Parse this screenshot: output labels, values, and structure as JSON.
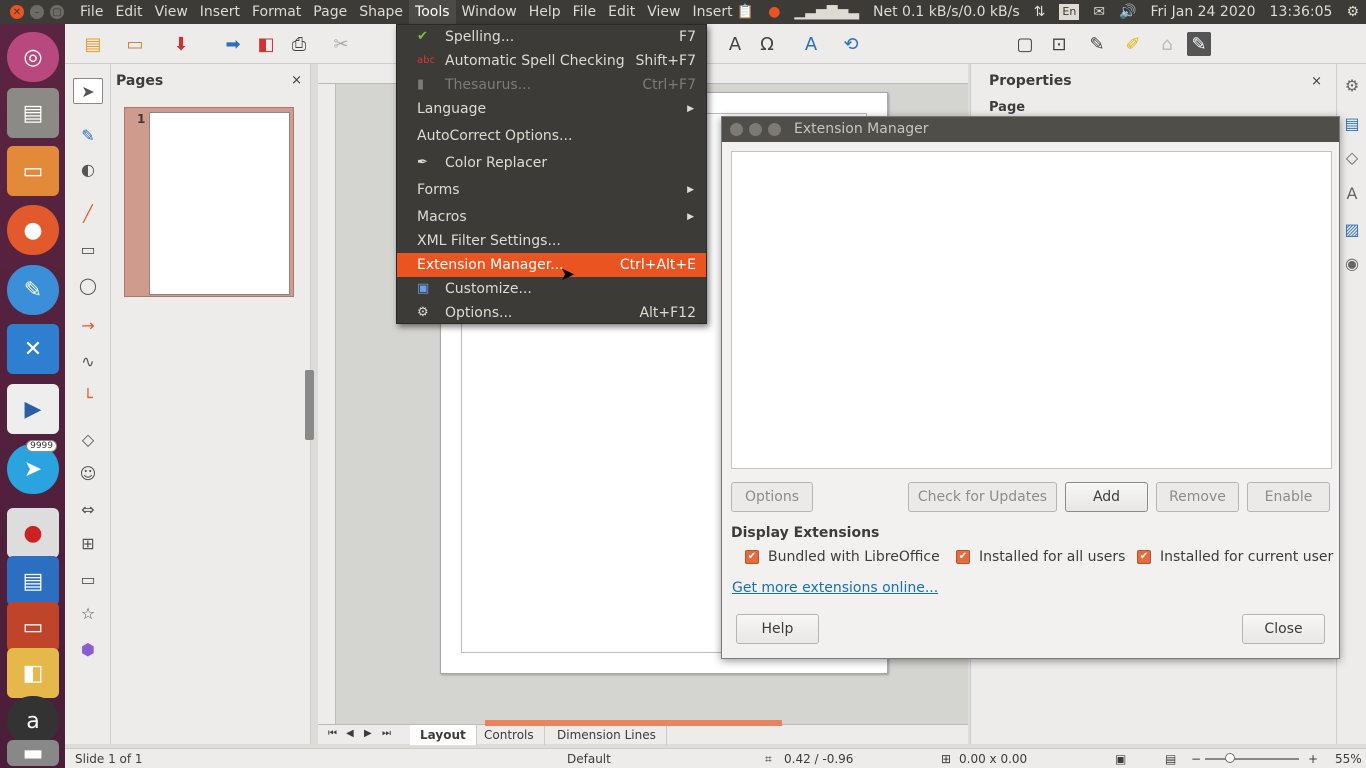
{
  "top_panel": {
    "app_menu": [
      "File",
      "Edit",
      "View",
      "Insert",
      "Format",
      "Page",
      "Shape",
      "Tools",
      "Window",
      "Help",
      "File",
      "Edit",
      "View",
      "Insert"
    ],
    "active_menu": "Tools",
    "network": "Net 0.1 kB/s/0.0 kB/s",
    "keyboard": "En",
    "datetime": "Fri Jan 24 2020",
    "time": "13:36:05"
  },
  "launcher": {
    "apps": [
      "ubuntu-logo",
      "files-drawer",
      "files-folder",
      "firefox",
      "krita",
      "xmind",
      "kdenlive",
      "telegram",
      "recorder",
      "writer",
      "impress",
      "draw",
      "amazon",
      "drive"
    ],
    "telegram_badge": "9999"
  },
  "pages_panel": {
    "title": "Pages",
    "close": "×",
    "page_number": "1"
  },
  "tools_menu": {
    "items": [
      {
        "label": "Spelling...",
        "shortcut": "F7",
        "icon": "check-icon"
      },
      {
        "label": "Automatic Spell Checking",
        "shortcut": "Shift+F7",
        "icon": "spellwave-icon"
      },
      {
        "label": "Thesaurus...",
        "shortcut": "Ctrl+F7",
        "icon": "book-icon"
      },
      {
        "label": "Language"
      },
      {
        "label": "AutoCorrect Options..."
      },
      {
        "label": "Color Replacer",
        "icon": "dropper-icon"
      },
      {
        "label": "Forms"
      },
      {
        "label": "Macros"
      },
      {
        "label": "XML Filter Settings..."
      },
      {
        "label": "Extension Manager...",
        "shortcut": "Ctrl+Alt+E"
      },
      {
        "label": "Customize...",
        "icon": "customize-icon"
      },
      {
        "label": "Options...",
        "shortcut": "Alt+F12",
        "icon": "gear-icon"
      }
    ]
  },
  "extension_manager": {
    "title": "Extension Manager",
    "buttons": {
      "options": "Options",
      "check_updates": "Check for Updates",
      "add": "Add",
      "remove": "Remove",
      "enable": "Enable",
      "help": "Help",
      "close": "Close"
    },
    "display_header": "Display Extensions",
    "checkboxes": {
      "bundled": "Bundled with LibreOffice",
      "all_users": "Installed for all users",
      "current_user": "Installed for current user"
    },
    "link": "Get more extensions online..."
  },
  "properties_panel": {
    "title": "Properties",
    "close": "×",
    "section": "Page"
  },
  "bottom_tabs": {
    "layout": "Layout",
    "controls": "Controls",
    "dimension_lines": "Dimension Lines"
  },
  "status_bar": {
    "slide": "Slide 1 of 1",
    "master": "Default",
    "position": "0.42 / -0.96",
    "size": "0.00 x 0.00",
    "zoom": "55%"
  }
}
